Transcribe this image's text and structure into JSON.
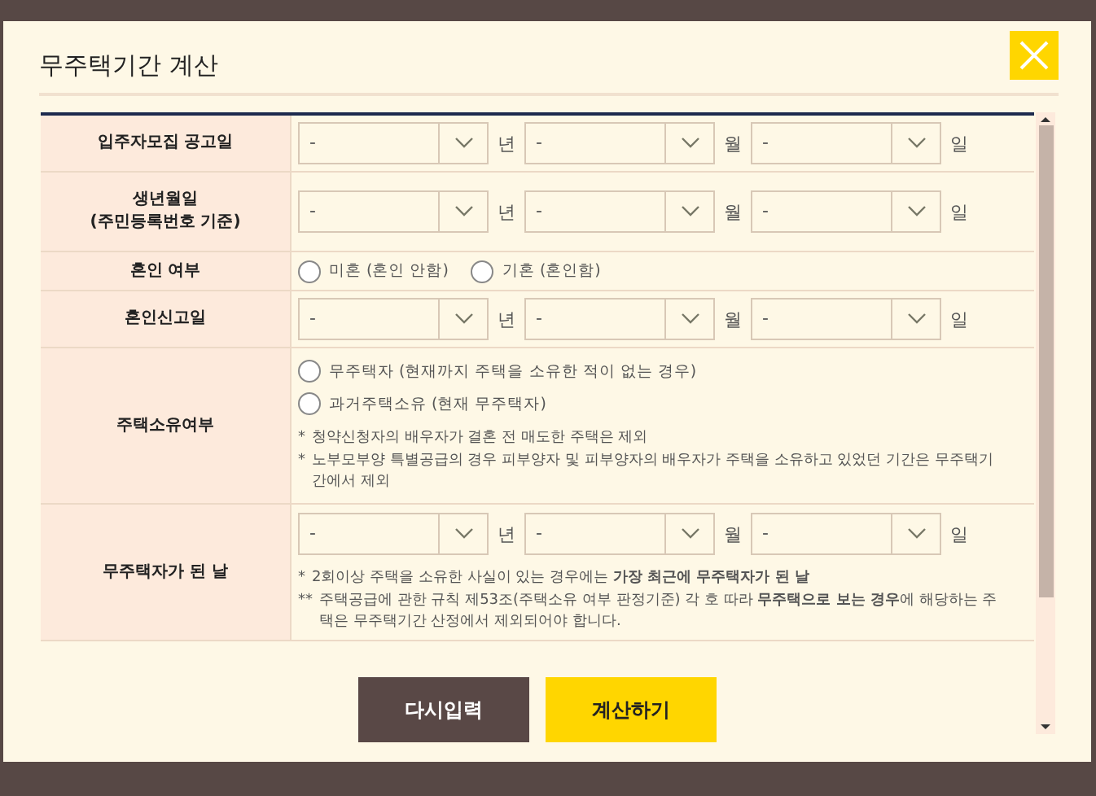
{
  "dialog": {
    "title": "무주택기간 계산"
  },
  "rows": [
    {
      "kind": "date",
      "label": "입주자모집 공고일",
      "selects": [
        {
          "value": "-",
          "unit": "년"
        },
        {
          "value": "-",
          "unit": "월"
        },
        {
          "value": "-",
          "unit": "일"
        }
      ]
    },
    {
      "kind": "date",
      "label": "생년월일\n(주민등록번호 기준)",
      "selects": [
        {
          "value": "-",
          "unit": "년"
        },
        {
          "value": "-",
          "unit": "월"
        },
        {
          "value": "-",
          "unit": "일"
        }
      ]
    },
    {
      "kind": "radio",
      "label": "혼인 여부",
      "options": [
        {
          "label": "미혼 (혼인 안함)",
          "selected": false
        },
        {
          "label": "기혼 (혼인함)",
          "selected": false
        }
      ]
    },
    {
      "kind": "date",
      "label": "혼인신고일",
      "selects": [
        {
          "value": "-",
          "unit": "년"
        },
        {
          "value": "-",
          "unit": "월"
        },
        {
          "value": "-",
          "unit": "일"
        }
      ]
    },
    {
      "kind": "radio",
      "label": "주택소유여부",
      "options": [
        {
          "label": "무주택자 (현재까지 주택을 소유한 적이 없는 경우)",
          "selected": false
        },
        {
          "label": "과거주택소유 (현재 무주택자)",
          "selected": false
        }
      ],
      "notes": [
        {
          "mark": "*",
          "text": "청약신청자의 배우자가 결혼 전 매도한 주택은 제외"
        },
        {
          "mark": "*",
          "text": "노부모부양 특별공급의 경우 피부양자 및 피부양자의 배우자가 주택을 소유하고 있었던 기간은 무주택기간에서 제외"
        }
      ]
    },
    {
      "kind": "date",
      "label": "무주택자가 된 날",
      "selects": [
        {
          "value": "-",
          "unit": "년"
        },
        {
          "value": "-",
          "unit": "월"
        },
        {
          "value": "-",
          "unit": "일"
        }
      ],
      "notes": [
        {
          "mark": "*",
          "text": "2회이상 주택을 소유한 사실이 있는 경우에는 **가장 최근에 무주택자가 된 날**"
        },
        {
          "mark": "**",
          "text": "주택공급에 관한 규칙 제53조(주택소유 여부 판정기준) 각 호 따라 **무주택으로 보는 경우**에 해당하는 주택은 무주택기간 산정에서 제외되어야 합니다."
        }
      ]
    }
  ],
  "buttons": [
    {
      "kind": "reset",
      "label": "다시입력"
    },
    {
      "kind": "submit",
      "label": "계산하기"
    }
  ]
}
